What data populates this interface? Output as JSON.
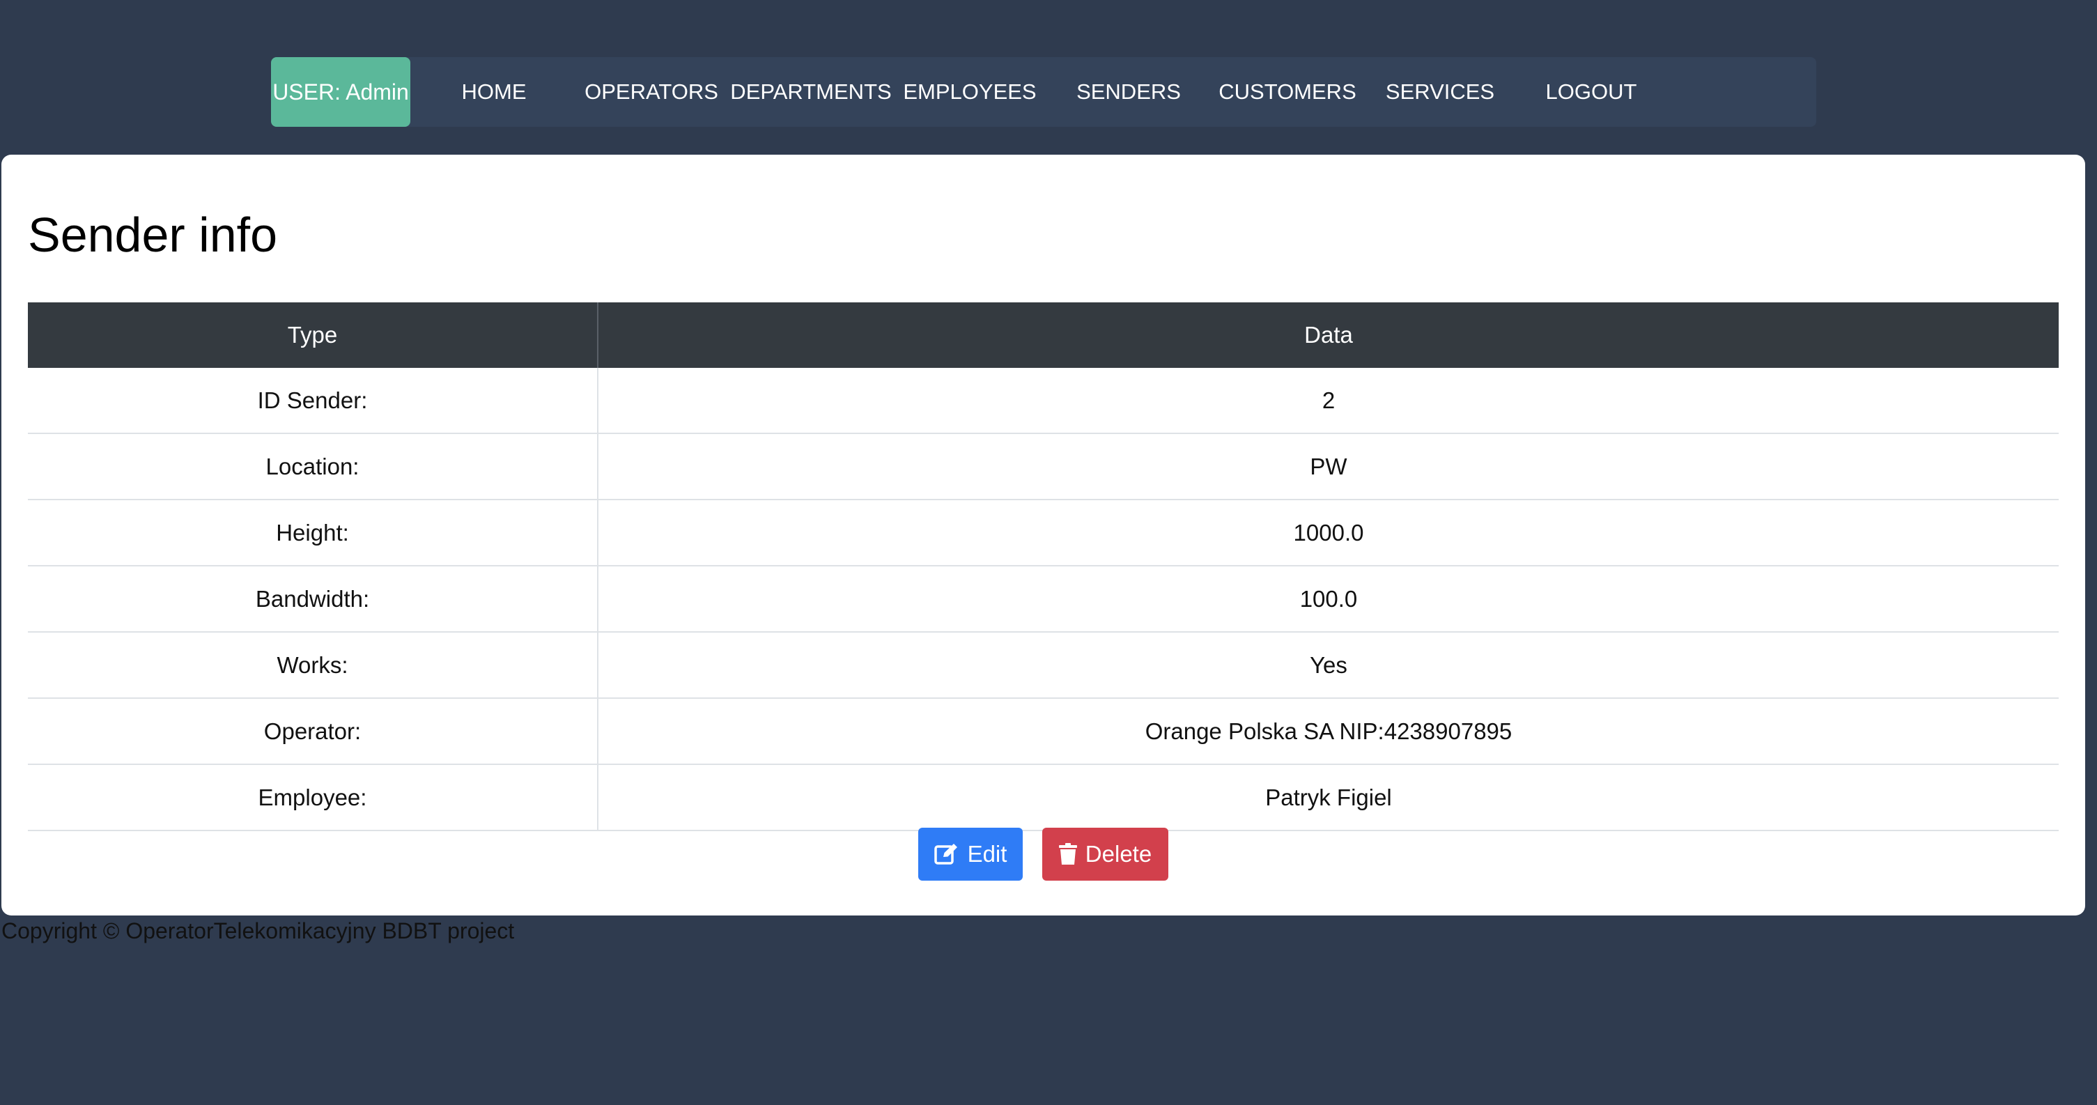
{
  "nav": {
    "user_label": "USER: Admin",
    "items": [
      "HOME",
      "OPERATORS",
      "DEPARTMENTS",
      "EMPLOYEES",
      "SENDERS",
      "CUSTOMERS",
      "SERVICES",
      "LOGOUT"
    ]
  },
  "page": {
    "title": "Sender info"
  },
  "table": {
    "headers": [
      "Type",
      "Data"
    ],
    "rows": [
      {
        "type": "ID Sender:",
        "data": "2"
      },
      {
        "type": "Location:",
        "data": "PW"
      },
      {
        "type": "Height:",
        "data": "1000.0"
      },
      {
        "type": "Bandwidth:",
        "data": "100.0"
      },
      {
        "type": "Works:",
        "data": "Yes"
      },
      {
        "type": "Operator:",
        "data": "Orange Polska SA NIP:4238907895"
      },
      {
        "type": "Employee:",
        "data": "Patryk Figiel"
      }
    ]
  },
  "actions": {
    "edit_label": "Edit",
    "delete_label": "Delete"
  },
  "footer": {
    "text": "Copyright © OperatorTelekomikacyjny BDBT project"
  },
  "colors": {
    "background": "#2f3b4f",
    "navbar": "#34435a",
    "user_badge": "#5bb89a",
    "table_header": "#343a40",
    "edit_button": "#2f7cf6",
    "delete_button": "#d2404c"
  },
  "icons": {
    "edit": "edit-icon",
    "delete": "trash-icon"
  }
}
